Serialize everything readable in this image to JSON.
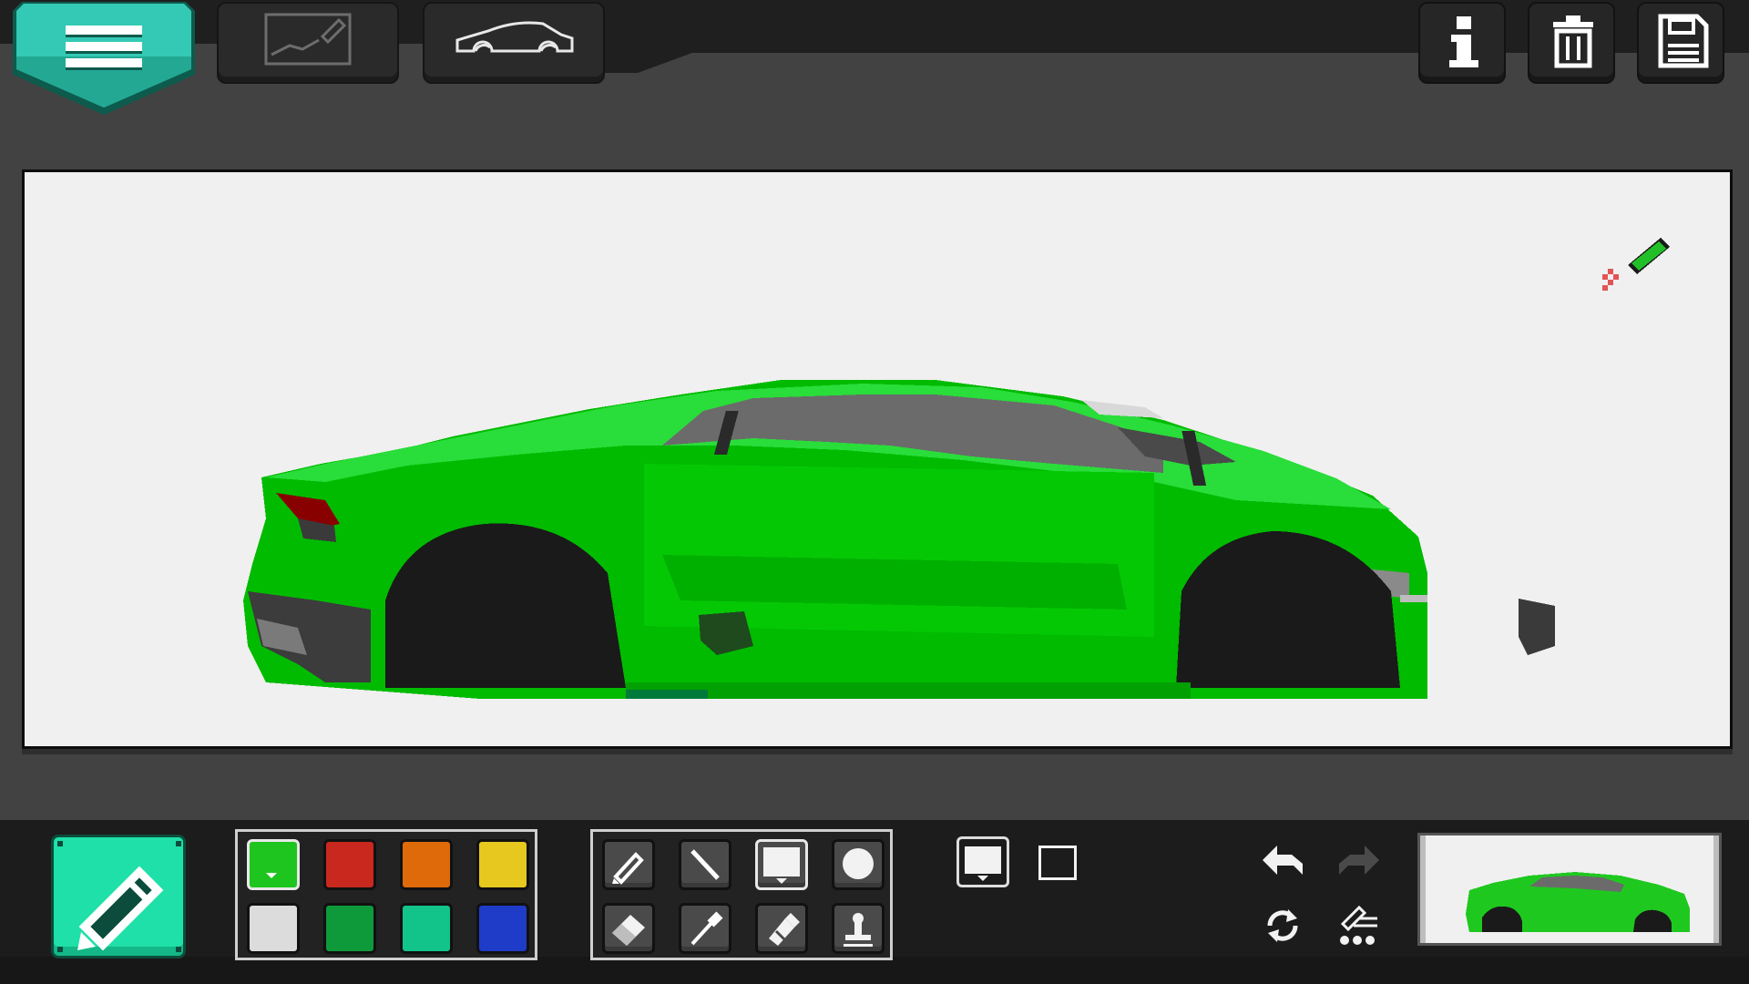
{
  "app": {
    "accent": "#22d4aa"
  },
  "topbar": {
    "menu_icon": "hamburger-menu-icon",
    "tabs": [
      {
        "icon": "sketch-frame-icon"
      },
      {
        "icon": "car-outline-icon"
      }
    ],
    "actions": [
      {
        "icon": "info-icon"
      },
      {
        "icon": "trash-icon"
      },
      {
        "icon": "save-floppy-icon"
      }
    ]
  },
  "canvas": {
    "background": "#f0f0f0",
    "cursor_icon": "green-pencil-cursor-icon",
    "drawing": "green-sports-car-pixel-art"
  },
  "toolbar": {
    "mode_icon": "pencil-icon",
    "palette": [
      {
        "color": "#1ec51e",
        "selected": true
      },
      {
        "color": "#c9281e",
        "selected": false
      },
      {
        "color": "#df6a0a",
        "selected": false
      },
      {
        "color": "#e6c81e",
        "selected": false
      },
      {
        "color": "#dcdcdc",
        "selected": false
      },
      {
        "color": "#0e9a3a",
        "selected": false
      },
      {
        "color": "#12c48a",
        "selected": false
      },
      {
        "color": "#1e3cc8",
        "selected": false
      }
    ],
    "tools": [
      {
        "icon": "pencil-tool-icon"
      },
      {
        "icon": "line-tool-icon"
      },
      {
        "icon": "brush-size-large-icon"
      },
      {
        "icon": "circle-tool-icon"
      },
      {
        "icon": "eraser-tool-icon"
      },
      {
        "icon": "eyedropper-tool-icon"
      },
      {
        "icon": "fill-marker-tool-icon"
      },
      {
        "icon": "stamp-tool-icon"
      }
    ],
    "sizes": [
      {
        "icon": "size-large-icon"
      },
      {
        "icon": "size-small-icon"
      }
    ],
    "history": [
      {
        "icon": "undo-icon"
      },
      {
        "icon": "redo-icon"
      },
      {
        "icon": "refresh-icon"
      },
      {
        "icon": "layers-settings-icon"
      }
    ],
    "preview": "thumbnail-preview"
  }
}
